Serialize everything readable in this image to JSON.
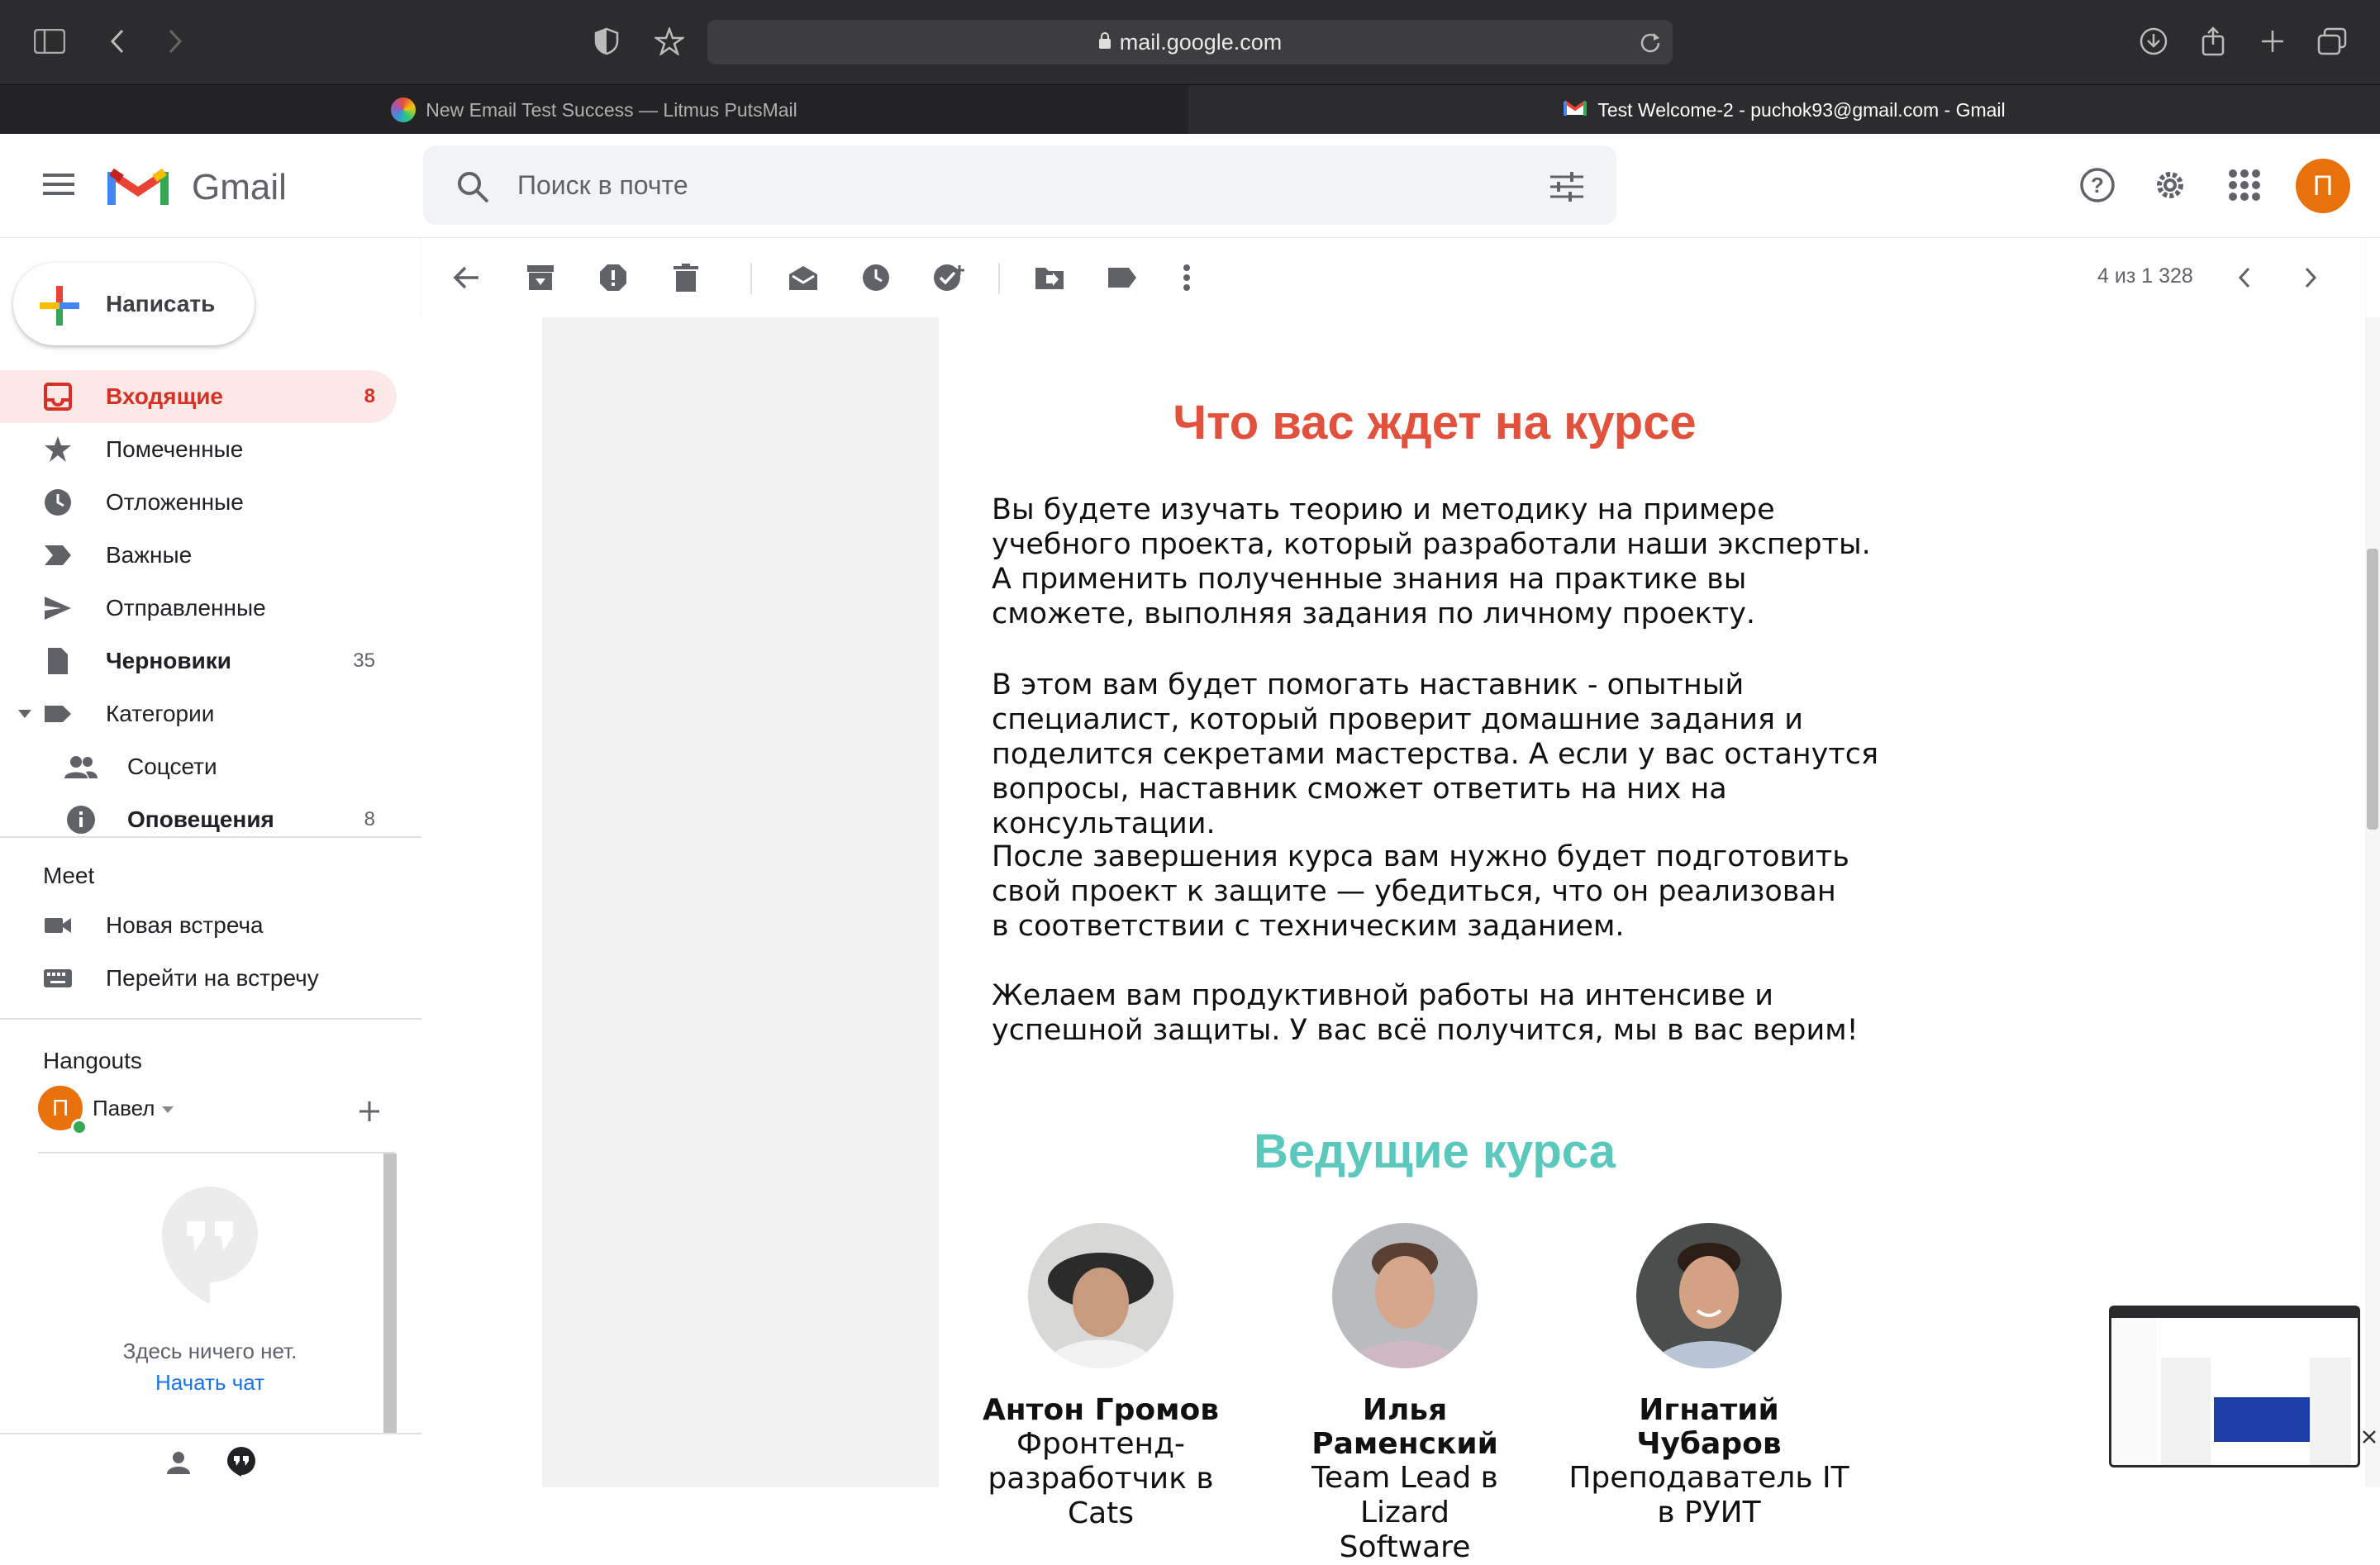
{
  "browser": {
    "url": "mail.google.com",
    "tabs": [
      {
        "title": "New Email Test Success — Litmus PutsMail"
      },
      {
        "title": "Test Welcome-2 - puchok93@gmail.com - Gmail"
      }
    ]
  },
  "gmail": {
    "logo_text": "Gmail",
    "search_placeholder": "Поиск в почте",
    "avatar_letter": "П"
  },
  "sidebar": {
    "compose_label": "Написать",
    "items": [
      {
        "label": "Входящие",
        "count": "8",
        "icon": "inbox-icon",
        "active": true
      },
      {
        "label": "Помеченные",
        "count": "",
        "icon": "star-icon"
      },
      {
        "label": "Отложенные",
        "count": "",
        "icon": "clock-icon"
      },
      {
        "label": "Важные",
        "count": "",
        "icon": "important-icon"
      },
      {
        "label": "Отправленные",
        "count": "",
        "icon": "send-icon"
      },
      {
        "label": "Черновики",
        "count": "35",
        "icon": "draft-icon"
      },
      {
        "label": "Категории",
        "count": "",
        "icon": "label-icon"
      },
      {
        "label": "Соцсети",
        "count": "",
        "icon": "people-icon"
      },
      {
        "label": "Оповещения",
        "count": "8",
        "icon": "info-icon"
      }
    ],
    "meet": {
      "title": "Meet",
      "new_meeting": "Новая встреча",
      "join_meeting": "Перейти на встречу"
    },
    "hangouts": {
      "title": "Hangouts",
      "user": "Павел",
      "user_letter": "П",
      "empty_text": "Здесь ничего нет.",
      "start_chat": "Начать чат"
    }
  },
  "toolbar": {
    "pagination": "4 из 1 328"
  },
  "email": {
    "section1_title": "Что вас ждет на курсе",
    "paragraphs": [
      "Вы будете изучать теорию и методику на примере учебного проекта, который разработали наши эксперты. А применить полученные знания на практике вы сможете, выполняя задания по личному проекту.",
      "В этом вам будет помогать наставник - опытный специалист, который проверит домашние задания и поделится секретами мастерства. А если у вас останутся вопросы, наставник сможет ответить на них на консультации.",
      "После завершения курса вам нужно будет подготовить свой проект к защите — убедиться, что он реализован в соответствии с техническим заданием.",
      "Желаем вам продуктивной работы на интенсиве и успешной защиты. У вас всё получится, мы в вас верим!"
    ],
    "section2_title": "Ведущие курса",
    "instructors": [
      {
        "name": "Антон Громов",
        "role_line1": "Фронтенд-",
        "role_line2": "разработчик в Cats"
      },
      {
        "name": "Илья Раменский",
        "role_line1": "Team Lead в Lizard",
        "role_line2": "Software"
      },
      {
        "name": "Игнатий Чубаров",
        "role_line1": "Преподаватель IT",
        "role_line2": "в РУИТ"
      }
    ]
  },
  "colors": {
    "accent_red": "#e2513b",
    "accent_teal": "#5bc8be",
    "gmail_red": "#d93025",
    "avatar_orange": "#e8710a"
  }
}
